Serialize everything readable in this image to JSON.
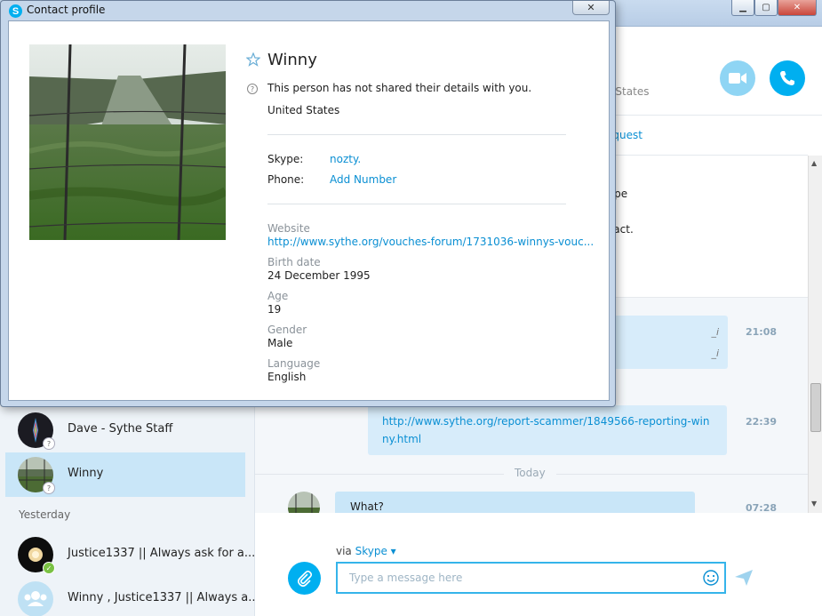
{
  "dialog": {
    "title": "Contact profile",
    "close_glyph": "✕",
    "name": "Winny",
    "privacy_note": "This person has not shared their details with you.",
    "location": "United States",
    "skype_label": "Skype:",
    "skype_value": "nozty.",
    "phone_label": "Phone:",
    "phone_value": "Add Number",
    "website_label": "Website",
    "website_value": "http://www.sythe.org/vouches-forum/1731036-winnys-vouc...",
    "birth_label": "Birth date",
    "birth_value": "24 December 1995",
    "age_label": "Age",
    "age_value": "19",
    "gender_label": "Gender",
    "gender_value": "Male",
    "language_label": "Language",
    "language_value": "English"
  },
  "main_window": {
    "header_location": "d States",
    "sub_link": "equest",
    "system_text_1": "ype",
    "system_text_2": "ntact.",
    "edit_mark": "_i"
  },
  "sidebar": {
    "contacts": [
      {
        "name": "Dave - Sythe Staff",
        "presence": "?"
      },
      {
        "name": "Winny",
        "presence": "?"
      }
    ],
    "group_label": "Yesterday",
    "recent": [
      {
        "name": "Justice1337 || Always ask for a...",
        "presence": "✓"
      },
      {
        "name": "Winny , Justice1337 || Always a..."
      }
    ]
  },
  "messages": {
    "time_1": "21:08",
    "link_message": "http://www.sythe.org/report-scammer/1849566-reporting-winny.html",
    "time_2": "22:39",
    "separator": "Today",
    "last_message": "What?",
    "time_3": "07:28"
  },
  "compose": {
    "via_label": "via",
    "via_link": "Skype ▾",
    "placeholder": "Type a message here"
  },
  "colors": {
    "accent": "#00aff0",
    "link": "#0a8fd3",
    "selected": "#c9e6f8"
  },
  "icons": [
    "skype-logo-icon",
    "close-icon",
    "star-icon",
    "info-icon",
    "video-call-icon",
    "phone-icon",
    "paperclip-icon",
    "emoji-icon",
    "send-icon",
    "group-icon"
  ]
}
